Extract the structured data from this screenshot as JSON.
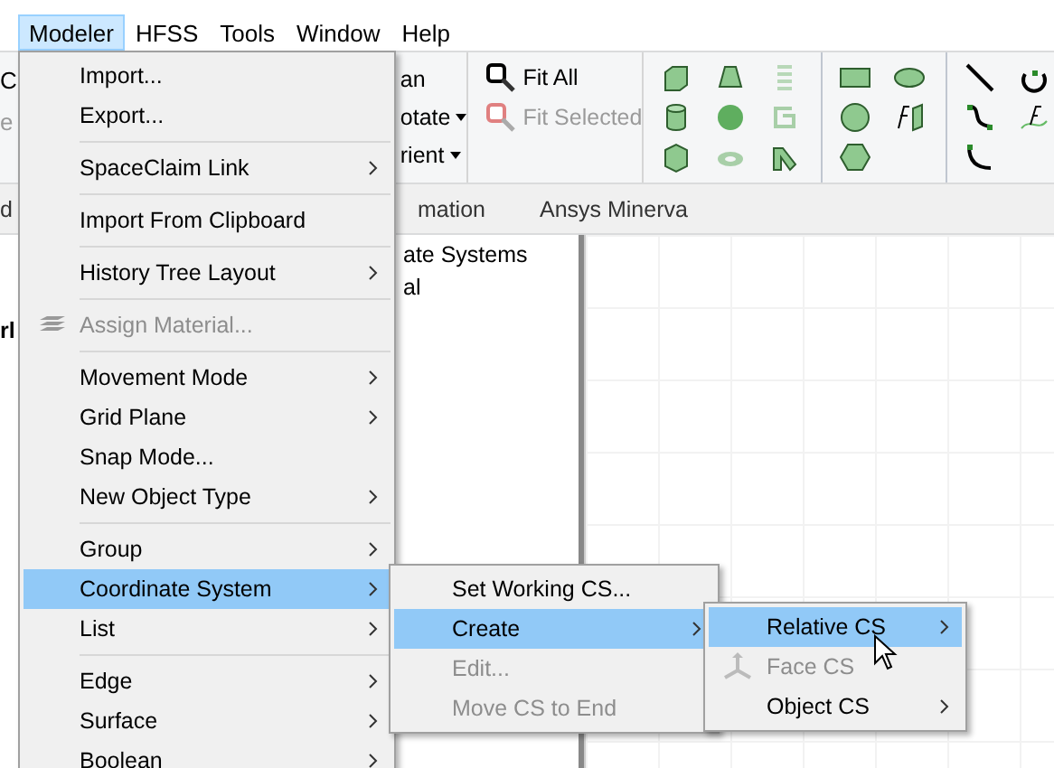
{
  "menubar": [
    {
      "label": "Modeler",
      "selected": true
    },
    {
      "label": "HFSS",
      "selected": false
    },
    {
      "label": "Tools",
      "selected": false
    },
    {
      "label": "Window",
      "selected": false
    },
    {
      "label": "Help",
      "selected": false
    }
  ],
  "ribbon": {
    "left_fragments": [
      "C",
      "e"
    ],
    "view_group": [
      {
        "label": "an",
        "dropdown": false
      },
      {
        "label": "otate",
        "dropdown": true
      },
      {
        "label": "rient",
        "dropdown": true
      }
    ],
    "fit_buttons": [
      {
        "label": "Fit All",
        "disabled": false
      },
      {
        "label": "Fit Selected",
        "disabled": true
      }
    ]
  },
  "tabs": [
    {
      "label": "d"
    },
    {
      "label": "mation"
    },
    {
      "label": "Ansys Minerva"
    }
  ],
  "project_tree": {
    "left_fragment": "rl",
    "items": [
      "ate Systems",
      "al"
    ]
  },
  "modeler_menu": [
    {
      "kind": "item",
      "label": "Import...",
      "submenu": false,
      "disabled": false,
      "selected": false
    },
    {
      "kind": "item",
      "label": "Export...",
      "submenu": false,
      "disabled": false,
      "selected": false
    },
    {
      "kind": "separator"
    },
    {
      "kind": "item",
      "label": "SpaceClaim Link",
      "submenu": true,
      "disabled": false,
      "selected": false
    },
    {
      "kind": "separator"
    },
    {
      "kind": "item",
      "label": "Import From Clipboard",
      "submenu": false,
      "disabled": false,
      "selected": false
    },
    {
      "kind": "separator"
    },
    {
      "kind": "item",
      "label": "History Tree Layout",
      "submenu": true,
      "disabled": false,
      "selected": false
    },
    {
      "kind": "separator"
    },
    {
      "kind": "iconitem",
      "label": "Assign Material...",
      "submenu": false,
      "disabled": true,
      "selected": false
    },
    {
      "kind": "separator"
    },
    {
      "kind": "item",
      "label": "Movement Mode",
      "submenu": true,
      "disabled": false,
      "selected": false
    },
    {
      "kind": "item",
      "label": "Grid Plane",
      "submenu": true,
      "disabled": false,
      "selected": false
    },
    {
      "kind": "item",
      "label": "Snap Mode...",
      "submenu": false,
      "disabled": false,
      "selected": false
    },
    {
      "kind": "item",
      "label": "New Object Type",
      "submenu": true,
      "disabled": false,
      "selected": false
    },
    {
      "kind": "separator"
    },
    {
      "kind": "item",
      "label": "Group",
      "submenu": true,
      "disabled": false,
      "selected": false
    },
    {
      "kind": "item",
      "label": "Coordinate System",
      "submenu": true,
      "disabled": false,
      "selected": true
    },
    {
      "kind": "item",
      "label": "List",
      "submenu": true,
      "disabled": false,
      "selected": false
    },
    {
      "kind": "separator"
    },
    {
      "kind": "item",
      "label": "Edge",
      "submenu": true,
      "disabled": false,
      "selected": false
    },
    {
      "kind": "item",
      "label": "Surface",
      "submenu": true,
      "disabled": false,
      "selected": false
    },
    {
      "kind": "item",
      "label": "Boolean",
      "submenu": true,
      "disabled": false,
      "selected": false
    }
  ],
  "coordinate_system_menu": [
    {
      "kind": "item",
      "label": "Set Working CS...",
      "submenu": false,
      "disabled": false,
      "selected": false
    },
    {
      "kind": "item",
      "label": "Create",
      "submenu": true,
      "disabled": false,
      "selected": true
    },
    {
      "kind": "item",
      "label": "Edit...",
      "submenu": false,
      "disabled": true,
      "selected": false
    },
    {
      "kind": "item",
      "label": "Move CS to End",
      "submenu": false,
      "disabled": true,
      "selected": false
    }
  ],
  "create_menu": [
    {
      "kind": "item",
      "label": "Relative CS",
      "submenu": true,
      "disabled": false,
      "selected": true
    },
    {
      "kind": "iconitem",
      "label": "Face CS",
      "submenu": false,
      "disabled": true,
      "selected": false
    },
    {
      "kind": "item",
      "label": "Object CS",
      "submenu": true,
      "disabled": false,
      "selected": false
    }
  ]
}
